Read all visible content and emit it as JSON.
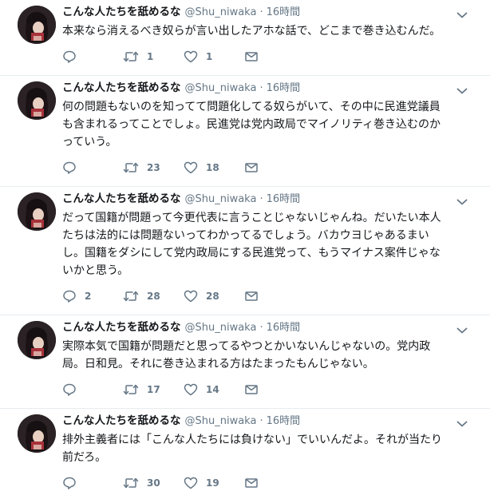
{
  "tweets": [
    {
      "name": "こんな人たちを舐めるな",
      "handle": "@Shu_niwaka",
      "separator": "·",
      "time": "16時間",
      "text": "本来なら消えるべき奴らが言い出したアホな話で、どこまで巻き込むんだ。",
      "replies": "",
      "retweets": "1",
      "likes": "1"
    },
    {
      "name": "こんな人たちを舐めるな",
      "handle": "@Shu_niwaka",
      "separator": "·",
      "time": "16時間",
      "text": "何の問題もないのを知ってて問題化してる奴らがいて、その中に民進党議員も含まれるってことでしょ。民進党は党内政局でマイノリティ巻き込むのかっていう。",
      "replies": "",
      "retweets": "23",
      "likes": "18"
    },
    {
      "name": "こんな人たちを舐めるな",
      "handle": "@Shu_niwaka",
      "separator": "·",
      "time": "16時間",
      "text": "だって国籍が問題って今更代表に言うことじゃないじゃんね。だいたい本人たちは法的には問題ないってわかってるでしょう。バカウヨじゃあるまいし。国籍をダシにして党内政局にする民進党って、もうマイナス案件じゃないかと思う。",
      "replies": "2",
      "retweets": "28",
      "likes": "28"
    },
    {
      "name": "こんな人たちを舐めるな",
      "handle": "@Shu_niwaka",
      "separator": "·",
      "time": "16時間",
      "text": "実際本気で国籍が問題だと思ってるやつとかいないんじゃないの。党内政局。日和見。それに巻き込まれる方はたまったもんじゃない。",
      "replies": "",
      "retweets": "17",
      "likes": "14"
    },
    {
      "name": "こんな人たちを舐めるな",
      "handle": "@Shu_niwaka",
      "separator": "·",
      "time": "16時間",
      "text": "排外主義者には「こんな人たちには負けない」でいいんだよ。それが当たり前だろ。",
      "replies": "",
      "retweets": "30",
      "likes": "19"
    }
  ]
}
